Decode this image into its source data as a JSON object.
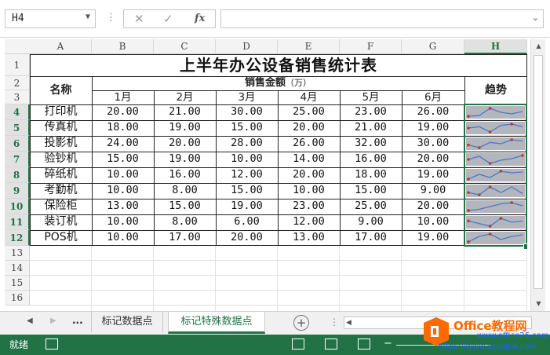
{
  "formula_bar": {
    "name_box": "H4",
    "fx_label": "fx",
    "formula": ""
  },
  "columns": [
    "A",
    "B",
    "C",
    "D",
    "E",
    "F",
    "G",
    "H"
  ],
  "rows": [
    "1",
    "2",
    "3",
    "4",
    "5",
    "6",
    "7",
    "8",
    "9",
    "10",
    "11",
    "12",
    "13",
    "14",
    "15",
    "16"
  ],
  "selected_cell": {
    "column": "H",
    "row": "4"
  },
  "table": {
    "title": "上半年办公设备销售统计表",
    "name_header": "名称",
    "sales_header": "销售金额",
    "sales_unit": "（万）",
    "trend_header": "趋势",
    "months": [
      "1月",
      "2月",
      "3月",
      "4月",
      "5月",
      "6月"
    ],
    "items": [
      {
        "name": "打印机",
        "values": [
          "20.00",
          "21.00",
          "30.00",
          "25.00",
          "23.00",
          "26.00"
        ]
      },
      {
        "name": "传真机",
        "values": [
          "18.00",
          "19.00",
          "15.00",
          "20.00",
          "21.00",
          "19.00"
        ]
      },
      {
        "name": "投影机",
        "values": [
          "24.00",
          "20.00",
          "28.00",
          "26.00",
          "32.00",
          "30.00"
        ]
      },
      {
        "name": "验钞机",
        "values": [
          "15.00",
          "19.00",
          "10.00",
          "14.00",
          "16.00",
          "20.00"
        ]
      },
      {
        "name": "碎纸机",
        "values": [
          "10.00",
          "16.00",
          "12.00",
          "20.00",
          "18.00",
          "19.00"
        ]
      },
      {
        "name": "考勤机",
        "values": [
          "10.00",
          "8.00",
          "15.00",
          "10.00",
          "15.00",
          "9.00"
        ]
      },
      {
        "name": "保险柜",
        "values": [
          "13.00",
          "15.00",
          "19.00",
          "23.00",
          "25.00",
          "20.00"
        ]
      },
      {
        "name": "装订机",
        "values": [
          "10.00",
          "8.00",
          "6.00",
          "12.00",
          "9.00",
          "10.00"
        ]
      },
      {
        "name": "POS机",
        "values": [
          "10.00",
          "17.00",
          "20.00",
          "13.00",
          "17.00",
          "19.00"
        ]
      }
    ]
  },
  "sparkline_style": {
    "line_color": "#4a78c8",
    "marker_color": "#c0392b",
    "background": "#b3b6bd"
  },
  "sheet_tabs": {
    "nav_more": "...",
    "tabs": [
      "标记数据点",
      "标记特殊数据点"
    ],
    "active_index": 1
  },
  "status_bar": {
    "text": "就绪"
  },
  "watermark": {
    "brand": "Office教程网",
    "url1": "www.office26.com",
    "url2": "https://www.excelcw.com"
  },
  "colors": {
    "accent": "#217346",
    "watermark_orange": "#ff6a00"
  }
}
